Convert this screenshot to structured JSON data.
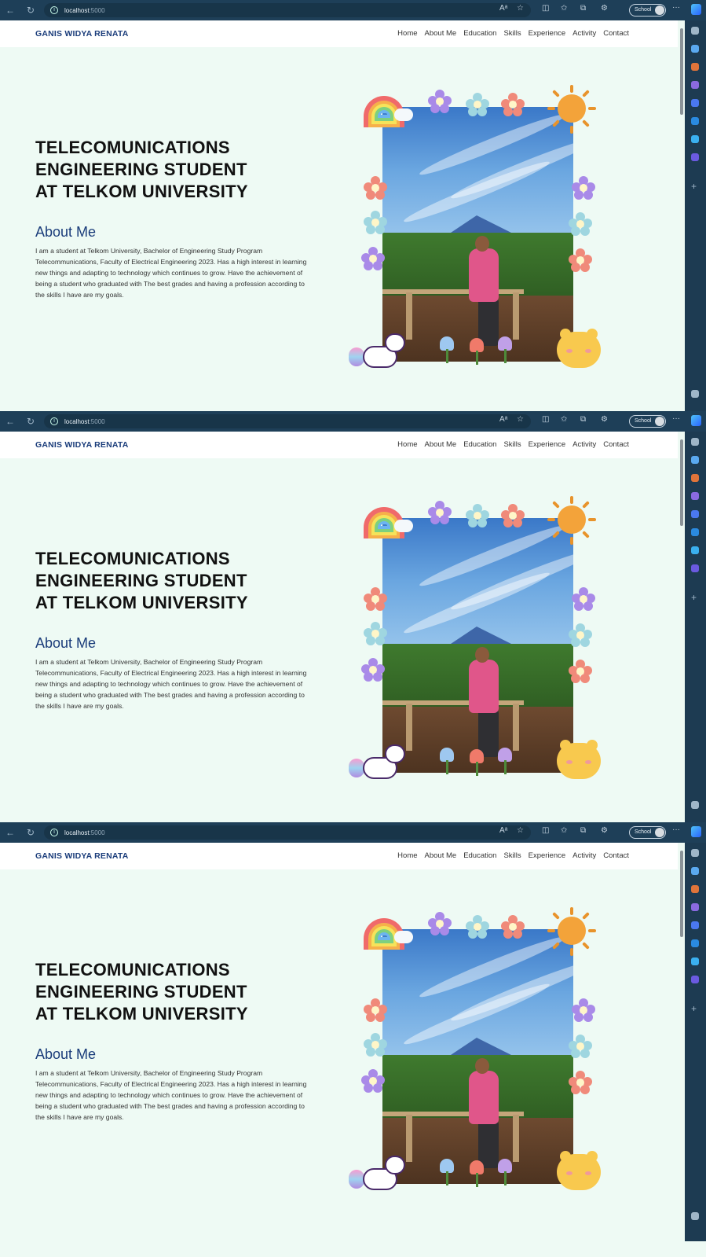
{
  "browser": {
    "url_host": "localhost",
    "url_port": ":5000",
    "profile_label": "School"
  },
  "nav": {
    "brand": "GANIS WIDYA RENATA",
    "items": [
      "Home",
      "About Me",
      "Education",
      "Skills",
      "Experience",
      "Activity",
      "Contact"
    ]
  },
  "hero": {
    "title_lines": [
      "TELECOMUNICATIONS",
      "ENGINEERING STUDENT",
      "AT TELKOM UNIVERSITY"
    ]
  },
  "about": {
    "heading": "About Me",
    "paragraph": "I am a student at Telkom University, Bachelor of Engineering Study Program Telecommunications, Faculty of Electrical Engineering 2023. Has a high interest in learning new things and adapting to technology which continues to grow. Have the achievement of being a student who graduated with The best grades and having a profession according to the skills I have are my goals."
  },
  "colors": {
    "brand": "#1a3c7a",
    "page_bg": "#eefaf4",
    "browser_chrome": "#1e3f58"
  }
}
